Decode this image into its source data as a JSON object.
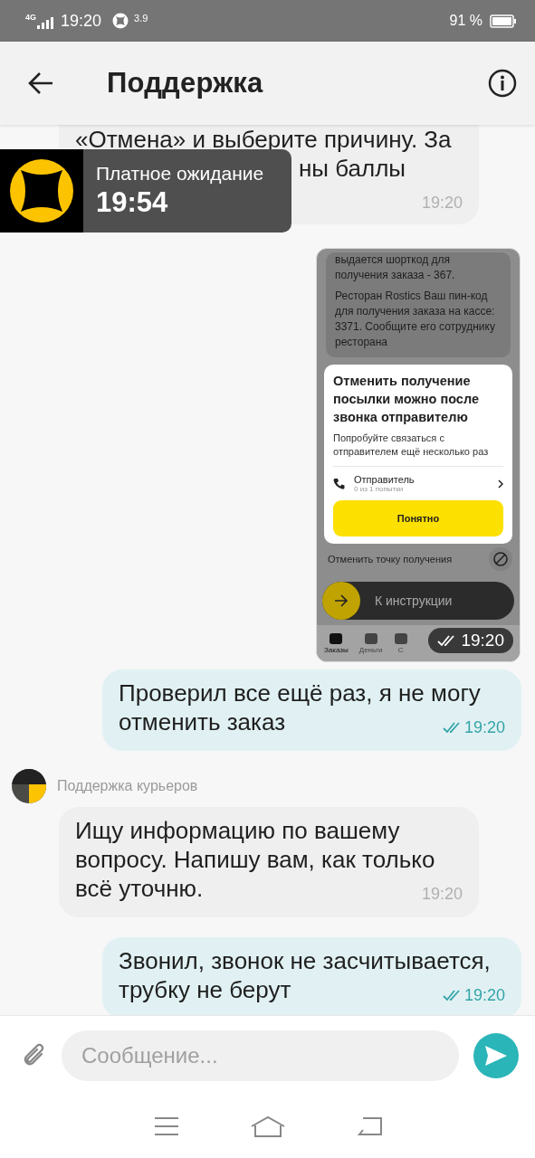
{
  "status_bar": {
    "network": "4G",
    "time": "19:20",
    "speed": "3.9",
    "battery": "91 %"
  },
  "header": {
    "title": "Поддержка"
  },
  "messages": [
    {
      "kind": "incoming",
      "partial_lines": [
        "«Отмена» и выберите причину. За",
        "ны баллы"
      ],
      "time": "19:20"
    },
    {
      "kind": "screenshot",
      "time": "19:20",
      "shot": {
        "notes": [
          "выдается шорткод для получения заказа - 367.",
          "Ресторан Rostics Ваш пин-код для получения заказа на кассе: 3371. Сообщите его сотруднику ресторана"
        ],
        "dialog": {
          "title": "Отменить получение посылки можно после звонка отправителю",
          "text": "Попробуйте связаться с отправителем ещё несколько раз",
          "contact": "Отправитель",
          "attempts": "0 из 1 попытки",
          "button": "Понятно"
        },
        "cancel_point": "Отменить точку получения",
        "slider": {
          "label": "К инструкции",
          "level": 0
        },
        "tabs": [
          {
            "label": "Заказы",
            "selected": true
          },
          {
            "label": "Деньги",
            "selected": false
          },
          {
            "label": "С",
            "selected": false
          }
        ]
      }
    },
    {
      "kind": "outgoing",
      "text": "Проверил все ещё раз, я не могу отменить заказ",
      "time": "19:20"
    },
    {
      "kind": "incoming",
      "sender": "Поддержка курьеров",
      "text": "Ищу информацию по вашему вопросу. Напишу вам, как только всё уточню.",
      "time": "19:20"
    },
    {
      "kind": "outgoing",
      "text": "Звонил, звонок не засчитывается, трубку не берут",
      "time": "19:20"
    }
  ],
  "wait_banner": {
    "label": "Платное ожидание",
    "timer": "19:54"
  },
  "composer": {
    "placeholder": "Сообщение..."
  }
}
